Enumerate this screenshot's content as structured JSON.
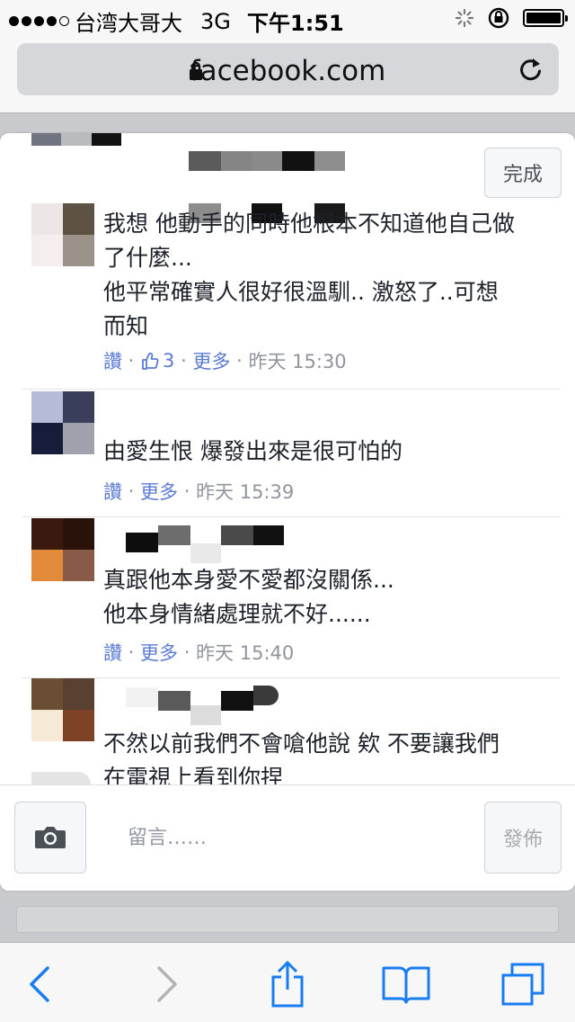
{
  "status_bar": {
    "carrier": "台湾大哥大",
    "network": "3G",
    "time": "下午1:51",
    "signal_bars": 4,
    "battery_level": 1.0
  },
  "browser": {
    "domain": "facebook.com",
    "icons": {
      "lock": "lock-icon",
      "reload": "reload-icon"
    }
  },
  "modal": {
    "done_label": "完成",
    "comments": [
      {
        "lines": [
          "我想 他動手的同時他根本不知道他自己做",
          "了什麼...",
          "他平常確實人很好很溫馴.. 激怒了..可想",
          "而知"
        ],
        "like_label": "讚",
        "like_count": "3",
        "more_label": "更多",
        "time": "昨天 15:30",
        "avatar_colors": [
          "#ece6e6",
          "#5e5244",
          "#f4eeee",
          "#9b928a"
        ]
      },
      {
        "lines": [
          "由愛生恨 爆發出來是很可怕的"
        ],
        "like_label": "讚",
        "more_label": "更多",
        "time": "昨天 15:39",
        "avatar_colors": [
          "#b4bcd8",
          "#393f5a",
          "#161d3a",
          "#9fa1ac"
        ]
      },
      {
        "lines": [
          "真跟他本身愛不愛都沒關係...",
          "他本身情緒處理就不好......"
        ],
        "like_label": "讚",
        "more_label": "更多",
        "time": "昨天 15:40",
        "avatar_colors": [
          "#3a1a0e",
          "#2a120a",
          "#e08a3a",
          "#8a5a48"
        ]
      },
      {
        "lines": [
          "不然以前我們不會嗆他說 欸 不要讓我們",
          "在電視上看到你捏"
        ],
        "avatar_colors": [
          "#6a4e34",
          "#5a4030",
          "#f6ead6",
          "#7e4226"
        ]
      }
    ],
    "composer": {
      "placeholder": "留言……",
      "post_label": "發佈",
      "camera_icon": "camera-icon"
    }
  },
  "toolbar": {
    "icons": [
      "back-icon",
      "forward-icon",
      "share-icon",
      "bookmarks-icon",
      "tabs-icon"
    ],
    "accent": "#1a7cf2"
  }
}
